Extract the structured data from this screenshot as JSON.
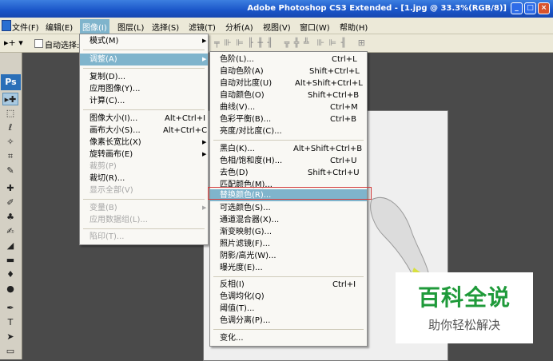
{
  "window": {
    "title": "Adobe Photoshop CS3 Extended - [1.jpg @ 33.3%(RGB/8)]"
  },
  "menubar": {
    "items": [
      {
        "label": "文件(F)"
      },
      {
        "label": "编辑(E)"
      },
      {
        "label": "图像(I)"
      },
      {
        "label": "图层(L)"
      },
      {
        "label": "选择(S)"
      },
      {
        "label": "滤镜(T)"
      },
      {
        "label": "分析(A)"
      },
      {
        "label": "视图(V)"
      },
      {
        "label": "窗口(W)"
      },
      {
        "label": "帮助(H)"
      }
    ],
    "active": "图像(I)"
  },
  "options_bar": {
    "auto_select_label": "自动选择:"
  },
  "toolbox": {
    "logo": "Ps"
  },
  "image_menu": {
    "items": [
      {
        "label": "模式(M)",
        "shortcut": "",
        "submenu": true
      },
      {
        "label": "调整(A)",
        "shortcut": "",
        "submenu": true
      },
      {
        "label": "复制(D)...",
        "shortcut": ""
      },
      {
        "label": "应用图像(Y)...",
        "shortcut": ""
      },
      {
        "label": "计算(C)...",
        "shortcut": ""
      },
      {
        "label": "图像大小(I)...",
        "shortcut": "Alt+Ctrl+I"
      },
      {
        "label": "画布大小(S)...",
        "shortcut": "Alt+Ctrl+C"
      },
      {
        "label": "像素长宽比(X)",
        "shortcut": "",
        "submenu": true
      },
      {
        "label": "旋转画布(E)",
        "shortcut": "",
        "submenu": true
      },
      {
        "label": "裁剪(P)",
        "shortcut": ""
      },
      {
        "label": "裁切(R)...",
        "shortcut": ""
      },
      {
        "label": "显示全部(V)",
        "shortcut": ""
      },
      {
        "label": "变量(B)",
        "shortcut": "",
        "submenu": true
      },
      {
        "label": "应用数据组(L)...",
        "shortcut": ""
      },
      {
        "label": "陷印(T)...",
        "shortcut": ""
      }
    ]
  },
  "adjust_menu": {
    "items": [
      {
        "label": "色阶(L)...",
        "shortcut": "Ctrl+L"
      },
      {
        "label": "自动色阶(A)",
        "shortcut": "Shift+Ctrl+L"
      },
      {
        "label": "自动对比度(U)",
        "shortcut": "Alt+Shift+Ctrl+L"
      },
      {
        "label": "自动颜色(O)",
        "shortcut": "Shift+Ctrl+B"
      },
      {
        "label": "曲线(V)...",
        "shortcut": "Ctrl+M"
      },
      {
        "label": "色彩平衡(B)...",
        "shortcut": "Ctrl+B"
      },
      {
        "label": "亮度/对比度(C)...",
        "shortcut": ""
      },
      {
        "label": "黑白(K)...",
        "shortcut": "Alt+Shift+Ctrl+B"
      },
      {
        "label": "色相/饱和度(H)...",
        "shortcut": "Ctrl+U"
      },
      {
        "label": "去色(D)",
        "shortcut": "Shift+Ctrl+U"
      },
      {
        "label": "匹配颜色(M)...",
        "shortcut": ""
      },
      {
        "label": "替换颜色(R)...",
        "shortcut": ""
      },
      {
        "label": "可选颜色(S)...",
        "shortcut": ""
      },
      {
        "label": "通道混合器(X)...",
        "shortcut": ""
      },
      {
        "label": "渐变映射(G)...",
        "shortcut": ""
      },
      {
        "label": "照片滤镜(F)...",
        "shortcut": ""
      },
      {
        "label": "阴影/高光(W)...",
        "shortcut": ""
      },
      {
        "label": "曝光度(E)...",
        "shortcut": ""
      },
      {
        "label": "反相(I)",
        "shortcut": "Ctrl+I"
      },
      {
        "label": "色调均化(Q)",
        "shortcut": ""
      },
      {
        "label": "阈值(T)...",
        "shortcut": ""
      },
      {
        "label": "色调分离(P)...",
        "shortcut": ""
      },
      {
        "label": "变化...",
        "shortcut": ""
      }
    ]
  },
  "watermark": {
    "main": "百科全说",
    "sub": "助你轻松解决"
  },
  "colors": {
    "highlight": "#7fb4cc",
    "title_bar": "#1a55c8",
    "watermark_green": "#1f9a3a"
  }
}
